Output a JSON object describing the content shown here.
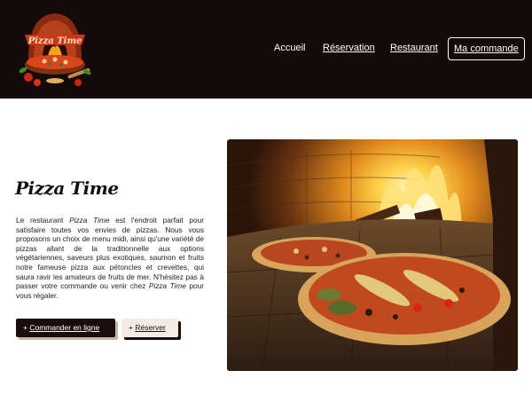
{
  "header": {
    "logo_text": "Pizza Time",
    "nav": {
      "home": "Accueil",
      "reservation": "Réservation",
      "restaurant": "Restaurant",
      "order": "Ma commande"
    }
  },
  "main": {
    "title": "Pizza Time",
    "paragraph_parts": [
      "Le restaurant ",
      "Pizza Time",
      " est l'endroit parfait pour satisfaire toutes vos envies de pizzas. Nous vous proposons un choix de menu midi, ainsi qu'une variété de pizzas allant de la traditionnelle aux options végétariennes, saveurs plus exotiques, saumon et fruits notre fameuse pizza aux pétoncles et crevettes, qui saura ravir les amateurs de fruits de mer. N'hésitez pas à passer votre commande ou venir chez ",
      "Pizza Time",
      " pour vous régaler."
    ],
    "buttons": {
      "order_prefix": "+ ",
      "order_label": "Commander en ligne",
      "reserve_prefix": "+ ",
      "reserve_label": "Réserver"
    }
  },
  "colors": {
    "header_bg": "#150a0a",
    "dark_button": "#1b0d0d",
    "light_button": "#f6ebe3"
  }
}
